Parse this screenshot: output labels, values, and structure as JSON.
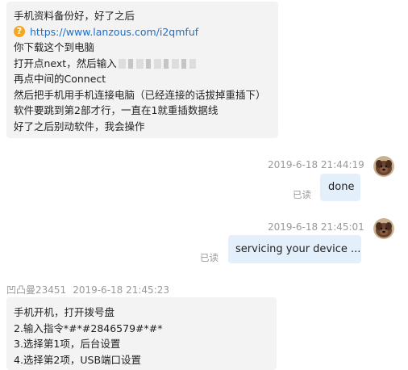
{
  "messages": {
    "first": {
      "lines": [
        "手机资料备份好，好了之后",
        "https://www.lanzous.com/i2qmfuf",
        "你下载这个到电脑",
        "打开点next，然后输入",
        "再点中间的Connect",
        "然后把手机用手机连接电脑（已经连接的话拔掉重插下）",
        "软件要跳到第2部才行，一直在1就重插数据线",
        "好了之后别动软件，我会操作"
      ]
    },
    "reply1": {
      "timestamp": "2019-6-18 21:44:19",
      "status": "已读",
      "text": "done"
    },
    "reply2": {
      "timestamp": "2019-6-18 21:45:01",
      "status": "已读",
      "text": "servicing your device ..."
    },
    "second": {
      "sender": "凹凸曼23451",
      "timestamp": "2019-6-18 21:45:23",
      "lines": [
        "手机开机，打开拨号盘",
        "2.输入指令*#*#2846579#*#*",
        "3.选择第1项，后台设置",
        "4.选择第2项，USB端口设置"
      ]
    }
  },
  "colors": {
    "incoming_bubble": "#f3f3f3",
    "outgoing_bubble": "#e4effc",
    "link": "#1a6fc9",
    "meta_text": "#999999",
    "link_icon": "#f5a623"
  },
  "icons": {
    "link": "question-circle-icon",
    "avatar": "dog-avatar-icon"
  }
}
